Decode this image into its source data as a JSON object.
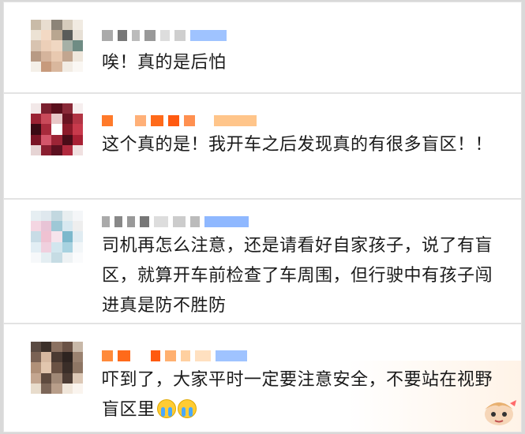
{
  "comments": [
    {
      "text": "唉！真的是后怕"
    },
    {
      "text": "这个真的是！我开车之后发现真的有很多盲区！！"
    },
    {
      "text": "司机再怎么注意，还是请看好自家孩子，说了有盲区，就算开车前检查了车周围，但行驶中有孩子闯进真是防不胜防"
    },
    {
      "text": "吓到了，大家平时一定要注意安全，不要站在视野盲区里"
    }
  ],
  "colors": {
    "text": "#1a1a1a",
    "card_bg": "#ffffff",
    "username_orange": "#ff6a1a",
    "username_blue": "#7fb2ff"
  },
  "icons": [
    "crying-emoji-icon",
    "crying-emoji-icon",
    "anime-sticker-icon"
  ]
}
